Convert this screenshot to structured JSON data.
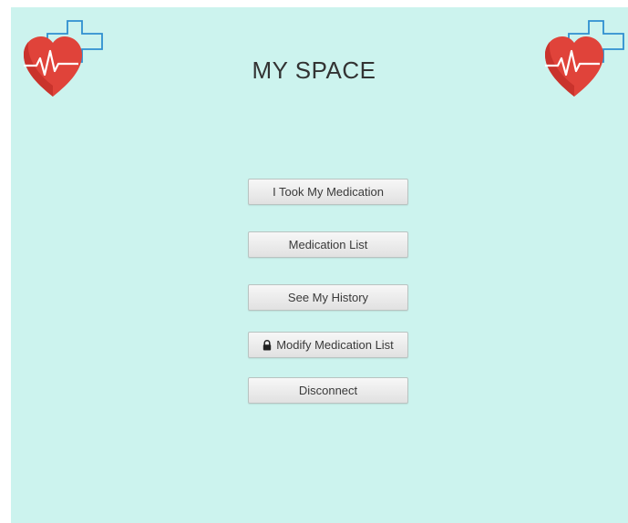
{
  "app": {
    "title": "MY SPACE",
    "logo_icon": "heart-pulse-cross-icon"
  },
  "menu": {
    "items": [
      {
        "label": "I Took My Medication",
        "icon": null
      },
      {
        "label": "Medication List",
        "icon": null
      },
      {
        "label": "See My History",
        "icon": null
      },
      {
        "label": "Modify Medication List",
        "icon": "lock-icon"
      },
      {
        "label": "Disconnect",
        "icon": null
      }
    ]
  },
  "colors": {
    "background": "#ccf3ee",
    "heart": "#e0433a",
    "cross": "#2f8fd0",
    "title": "#333333"
  }
}
